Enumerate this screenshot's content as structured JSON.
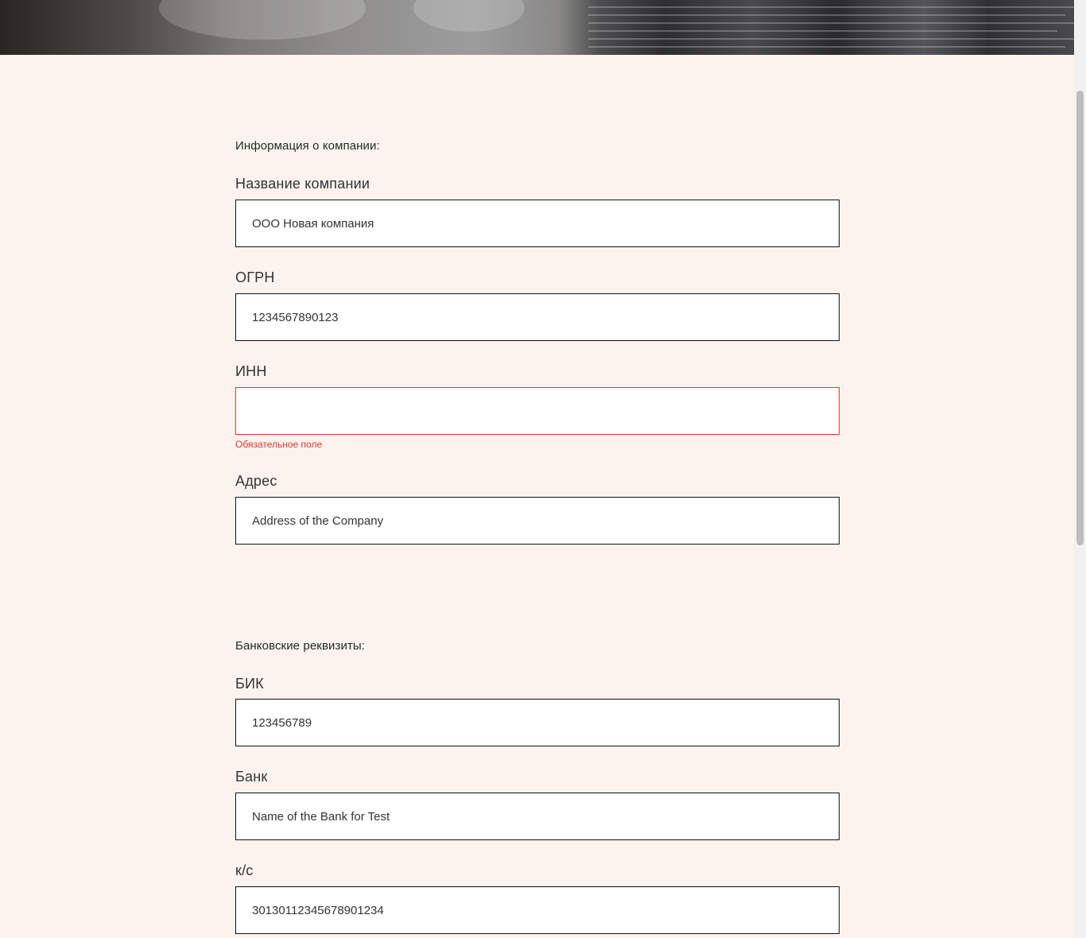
{
  "company_section": {
    "title": "Информация о компании:",
    "fields": {
      "name": {
        "label": "Название компании",
        "value": "ООО Новая компания"
      },
      "ogrn": {
        "label": "ОГРН",
        "value": "1234567890123"
      },
      "inn": {
        "label": "ИНН",
        "value": "",
        "error": "Обязательное поле"
      },
      "address": {
        "label": "Адрес",
        "value": "Address of the Company"
      }
    }
  },
  "bank_section": {
    "title": "Банковские реквизиты:",
    "fields": {
      "bik": {
        "label": "БИК",
        "value": "123456789"
      },
      "bank": {
        "label": "Банк",
        "value": "Name of the Bank for Test"
      },
      "ks": {
        "label": "к/с",
        "value": "30130112345678901234"
      }
    }
  },
  "colors": {
    "background": "#fcf3ee",
    "error": "#e0362b",
    "input_border": "#111111"
  }
}
